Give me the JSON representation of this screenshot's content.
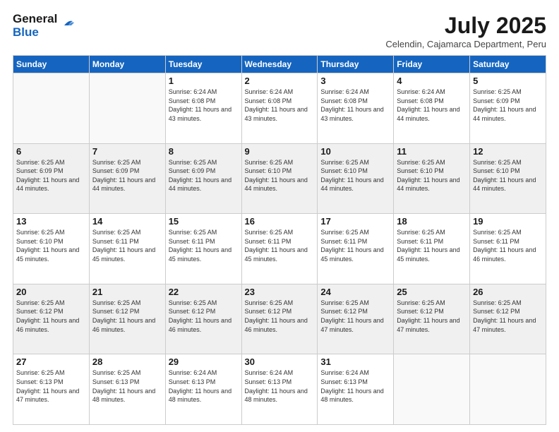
{
  "logo": {
    "line1": "General",
    "line2": "Blue"
  },
  "title": "July 2025",
  "subtitle": "Celendin, Cajamarca Department, Peru",
  "weekdays": [
    "Sunday",
    "Monday",
    "Tuesday",
    "Wednesday",
    "Thursday",
    "Friday",
    "Saturday"
  ],
  "weeks": [
    [
      {
        "day": "",
        "info": ""
      },
      {
        "day": "",
        "info": ""
      },
      {
        "day": "1",
        "info": "Sunrise: 6:24 AM\nSunset: 6:08 PM\nDaylight: 11 hours and 43 minutes."
      },
      {
        "day": "2",
        "info": "Sunrise: 6:24 AM\nSunset: 6:08 PM\nDaylight: 11 hours and 43 minutes."
      },
      {
        "day": "3",
        "info": "Sunrise: 6:24 AM\nSunset: 6:08 PM\nDaylight: 11 hours and 43 minutes."
      },
      {
        "day": "4",
        "info": "Sunrise: 6:24 AM\nSunset: 6:08 PM\nDaylight: 11 hours and 44 minutes."
      },
      {
        "day": "5",
        "info": "Sunrise: 6:25 AM\nSunset: 6:09 PM\nDaylight: 11 hours and 44 minutes."
      }
    ],
    [
      {
        "day": "6",
        "info": "Sunrise: 6:25 AM\nSunset: 6:09 PM\nDaylight: 11 hours and 44 minutes."
      },
      {
        "day": "7",
        "info": "Sunrise: 6:25 AM\nSunset: 6:09 PM\nDaylight: 11 hours and 44 minutes."
      },
      {
        "day": "8",
        "info": "Sunrise: 6:25 AM\nSunset: 6:09 PM\nDaylight: 11 hours and 44 minutes."
      },
      {
        "day": "9",
        "info": "Sunrise: 6:25 AM\nSunset: 6:10 PM\nDaylight: 11 hours and 44 minutes."
      },
      {
        "day": "10",
        "info": "Sunrise: 6:25 AM\nSunset: 6:10 PM\nDaylight: 11 hours and 44 minutes."
      },
      {
        "day": "11",
        "info": "Sunrise: 6:25 AM\nSunset: 6:10 PM\nDaylight: 11 hours and 44 minutes."
      },
      {
        "day": "12",
        "info": "Sunrise: 6:25 AM\nSunset: 6:10 PM\nDaylight: 11 hours and 44 minutes."
      }
    ],
    [
      {
        "day": "13",
        "info": "Sunrise: 6:25 AM\nSunset: 6:10 PM\nDaylight: 11 hours and 45 minutes."
      },
      {
        "day": "14",
        "info": "Sunrise: 6:25 AM\nSunset: 6:11 PM\nDaylight: 11 hours and 45 minutes."
      },
      {
        "day": "15",
        "info": "Sunrise: 6:25 AM\nSunset: 6:11 PM\nDaylight: 11 hours and 45 minutes."
      },
      {
        "day": "16",
        "info": "Sunrise: 6:25 AM\nSunset: 6:11 PM\nDaylight: 11 hours and 45 minutes."
      },
      {
        "day": "17",
        "info": "Sunrise: 6:25 AM\nSunset: 6:11 PM\nDaylight: 11 hours and 45 minutes."
      },
      {
        "day": "18",
        "info": "Sunrise: 6:25 AM\nSunset: 6:11 PM\nDaylight: 11 hours and 45 minutes."
      },
      {
        "day": "19",
        "info": "Sunrise: 6:25 AM\nSunset: 6:11 PM\nDaylight: 11 hours and 46 minutes."
      }
    ],
    [
      {
        "day": "20",
        "info": "Sunrise: 6:25 AM\nSunset: 6:12 PM\nDaylight: 11 hours and 46 minutes."
      },
      {
        "day": "21",
        "info": "Sunrise: 6:25 AM\nSunset: 6:12 PM\nDaylight: 11 hours and 46 minutes."
      },
      {
        "day": "22",
        "info": "Sunrise: 6:25 AM\nSunset: 6:12 PM\nDaylight: 11 hours and 46 minutes."
      },
      {
        "day": "23",
        "info": "Sunrise: 6:25 AM\nSunset: 6:12 PM\nDaylight: 11 hours and 46 minutes."
      },
      {
        "day": "24",
        "info": "Sunrise: 6:25 AM\nSunset: 6:12 PM\nDaylight: 11 hours and 47 minutes."
      },
      {
        "day": "25",
        "info": "Sunrise: 6:25 AM\nSunset: 6:12 PM\nDaylight: 11 hours and 47 minutes."
      },
      {
        "day": "26",
        "info": "Sunrise: 6:25 AM\nSunset: 6:12 PM\nDaylight: 11 hours and 47 minutes."
      }
    ],
    [
      {
        "day": "27",
        "info": "Sunrise: 6:25 AM\nSunset: 6:13 PM\nDaylight: 11 hours and 47 minutes."
      },
      {
        "day": "28",
        "info": "Sunrise: 6:25 AM\nSunset: 6:13 PM\nDaylight: 11 hours and 48 minutes."
      },
      {
        "day": "29",
        "info": "Sunrise: 6:24 AM\nSunset: 6:13 PM\nDaylight: 11 hours and 48 minutes."
      },
      {
        "day": "30",
        "info": "Sunrise: 6:24 AM\nSunset: 6:13 PM\nDaylight: 11 hours and 48 minutes."
      },
      {
        "day": "31",
        "info": "Sunrise: 6:24 AM\nSunset: 6:13 PM\nDaylight: 11 hours and 48 minutes."
      },
      {
        "day": "",
        "info": ""
      },
      {
        "day": "",
        "info": ""
      }
    ]
  ]
}
